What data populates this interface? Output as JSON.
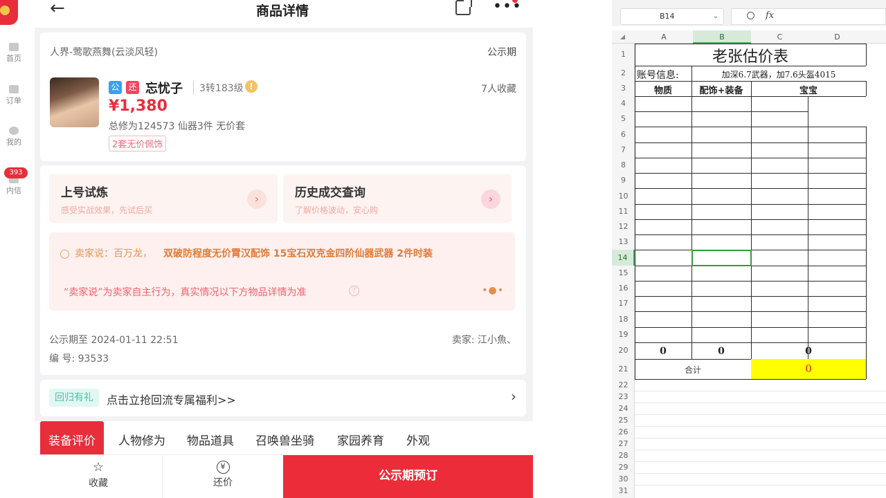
{
  "sidebar": {
    "items": [
      {
        "label": "首页"
      },
      {
        "label": "订单"
      },
      {
        "label": "我的"
      },
      {
        "label": "内信"
      }
    ],
    "badge": "393"
  },
  "header": {
    "back_icon": "←",
    "title": "商品详情",
    "more_icon": "•••"
  },
  "product": {
    "server": "人界-莺歌燕舞(云淡风轻)",
    "period_label": "公示期",
    "tag1": "公",
    "tag2": "还",
    "name": "忘忧子",
    "level": "3转183级",
    "warn_icon": "!",
    "favorites": "7人收藏",
    "price": "¥1,380",
    "attrs": "总修为124573  仙器3件  无价套",
    "pill": "2套无价佩饰"
  },
  "tiles": [
    {
      "title": "上号试炼",
      "sub": "感受实战效果，先试后买",
      "arrow": "›"
    },
    {
      "title": "历史成交查询",
      "sub": "了解价格波动，安心购",
      "arrow": "›"
    }
  ],
  "seller_says": {
    "prefix": "卖家说：百万龙，",
    "highlight": "双破防程度无价霄汉配饰 15宝石双克金四阶仙器武器 2件时装",
    "disclaimer": "“卖家说”为卖家自主行为，真实情况以下方物品详情为准",
    "q_icon": "?",
    "dots": "•●•"
  },
  "meta": {
    "until": "公示期至 2024-01-11 22:51",
    "seller": "卖家: 江小魚、",
    "number": "编 号: 93533"
  },
  "promo": {
    "tag": "回归有礼",
    "text": "点击立抢回流专属福利>>",
    "chevron": "›"
  },
  "tabs": [
    "装备评价",
    "人物修为",
    "物品道具",
    "召唤兽坐骑",
    "家园养育",
    "外观"
  ],
  "bottom": {
    "fav_icon": "☆",
    "fav_label": "收藏",
    "bargain_icon": "¥",
    "bargain_label": "还价",
    "buy_label": "公示期预订"
  },
  "sheet": {
    "cell_ref": "B14",
    "dropdown_icon": "⌄",
    "fx_label": "fx",
    "columns": [
      "A",
      "B",
      "C",
      "D"
    ],
    "selected_column": "B",
    "rows": [
      "1",
      "2",
      "3",
      "4",
      "5",
      "6",
      "7",
      "8",
      "9",
      "10",
      "11",
      "12",
      "13",
      "14",
      "15",
      "16",
      "17",
      "18",
      "19",
      "20",
      "21",
      "22",
      "23",
      "24",
      "25",
      "26",
      "27",
      "28",
      "29",
      "30",
      "31"
    ],
    "selected_row": "14",
    "title": "老张估价表",
    "account_label": "账号信息:",
    "account_value": "加深6.7武器，加7.6头盔4015",
    "headers": [
      "物质",
      "配饰+装备",
      "宝宝"
    ],
    "row20": [
      "0",
      "0",
      "0"
    ],
    "total_label": "合计",
    "total_value": "0",
    "highlight_color": "#ffff00",
    "total_text_color": "#e02020"
  }
}
